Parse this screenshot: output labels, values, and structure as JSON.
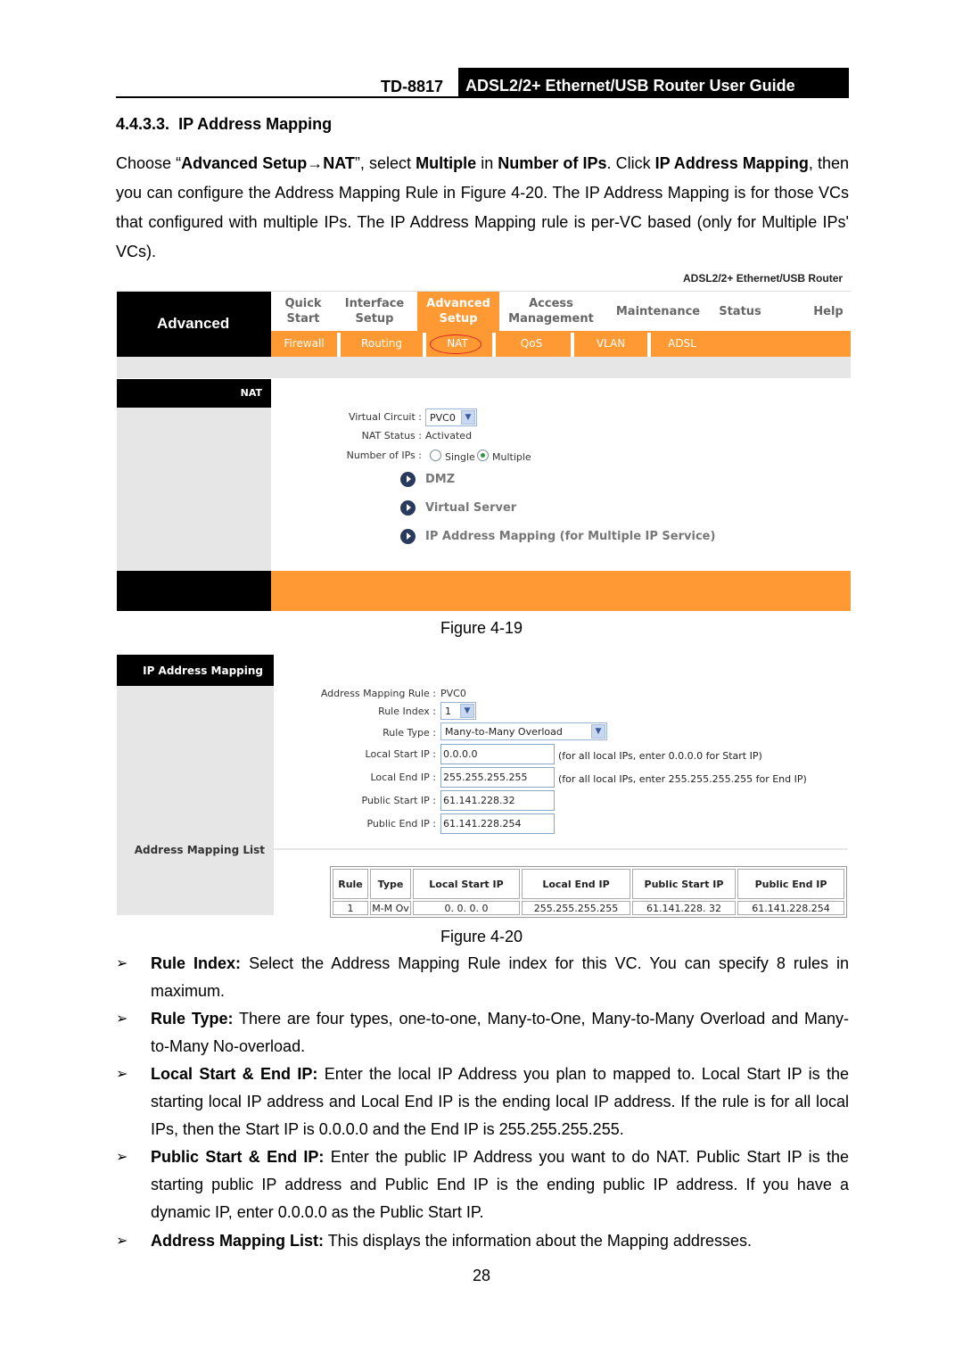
{
  "header": {
    "model": "TD-8817",
    "title": "ADSL2/2+ Ethernet/USB Router User Guide"
  },
  "section": {
    "number": "4.4.3.3.",
    "title": "IP Address Mapping"
  },
  "intro": {
    "p1": "Choose “",
    "b1": "Advanced Setup→NAT",
    "p2": "”, select ",
    "b2": "Multiple",
    "p3": " in ",
    "b3": "Number of IPs",
    "p4": ". Click ",
    "b4": "IP Address Mapping",
    "p5": ", then you can configure the Address Mapping Rule in Figure 4-20. The IP Address Mapping is for those VCs that configured with multiple IPs. The IP Address Mapping rule is per-VC based (only for Multiple IPs' VCs)."
  },
  "figure19": {
    "brand": "ADSL2/2+ Ethernet/USB Router",
    "section_label": "Advanced",
    "top_tabs": [
      {
        "line1": "Quick",
        "line2": "Start"
      },
      {
        "line1": "Interface",
        "line2": "Setup"
      },
      {
        "line1": "Advanced",
        "line2": "Setup"
      },
      {
        "line1": "Access",
        "line2": "Management"
      },
      {
        "line1": "Maintenance",
        "line2": ""
      },
      {
        "line1": "Status",
        "line2": ""
      },
      {
        "line1": "Help",
        "line2": ""
      }
    ],
    "active_tab": "Advanced Setup",
    "sub_tabs": [
      "Firewall",
      "Routing",
      "NAT",
      "QoS",
      "VLAN",
      "ADSL"
    ],
    "highlighted_sub_tab": "NAT",
    "panel_title": "NAT",
    "virtual_circuit_label": "Virtual Circuit :",
    "virtual_circuit_value": "PVC0",
    "nat_status_label": "NAT Status :",
    "nat_status_value": "Activated",
    "number_of_ips_label": "Number of IPs :",
    "option_single": "Single",
    "option_multiple": "Multiple",
    "selected_option": "Multiple",
    "links": [
      "DMZ",
      "Virtual Server",
      "IP Address Mapping (for Multiple IP Service)"
    ],
    "caption": "Figure 4-19"
  },
  "figure20": {
    "panel_title": "IP Address Mapping",
    "list_title": "Address Mapping List",
    "fields": {
      "rule_label": "Address Mapping Rule :",
      "rule_value": "PVC0",
      "rule_index_label": "Rule Index :",
      "rule_index_value": "1",
      "rule_type_label": "Rule Type :",
      "rule_type_value": "Many-to-Many Overload",
      "local_start_label": "Local Start IP :",
      "local_start_value": "0.0.0.0",
      "local_start_hint": "(for all local IPs, enter 0.0.0.0 for Start IP)",
      "local_end_label": "Local End IP :",
      "local_end_value": "255.255.255.255",
      "local_end_hint": "(for all local IPs, enter 255.255.255.255 for End IP)",
      "public_start_label": "Public Start IP :",
      "public_start_value": "61.141.228.32",
      "public_end_label": "Public End IP :",
      "public_end_value": "61.141.228.254"
    },
    "table": {
      "headers": [
        "Rule",
        "Type",
        "Local Start IP",
        "Local End IP",
        "Public Start IP",
        "Public End IP"
      ],
      "rows": [
        [
          "1",
          "M-M Ov",
          "0. 0. 0. 0",
          "255.255.255.255",
          "61.141.228. 32",
          "61.141.228.254"
        ]
      ]
    },
    "caption": "Figure 4-20"
  },
  "bullets": [
    {
      "term": "Rule Index:",
      "text": " Select the Address Mapping Rule index for this VC. You can specify 8 rules in maximum."
    },
    {
      "term": "Rule Type:",
      "text": " There are four types, one-to-one, Many-to-One, Many-to-Many Overload and Many-to-Many No-overload."
    },
    {
      "term": "Local Start & End IP:",
      "text": " Enter the local IP Address you plan to mapped to. Local Start IP is the starting local IP address and Local End IP is the ending local IP address. If the rule is for all local IPs, then the Start IP is 0.0.0.0 and the End IP is 255.255.255.255."
    },
    {
      "term": "Public Start & End IP:",
      "text": " Enter the public IP Address you want to do NAT. Public Start IP is the starting public IP address and Public End IP is the ending public IP address. If you have a dynamic IP, enter 0.0.0.0 as the Public Start IP."
    },
    {
      "term": "Address Mapping List:",
      "text": " This displays the information about the Mapping addresses."
    }
  ],
  "bullet_marker": "➢",
  "page_number": "28"
}
